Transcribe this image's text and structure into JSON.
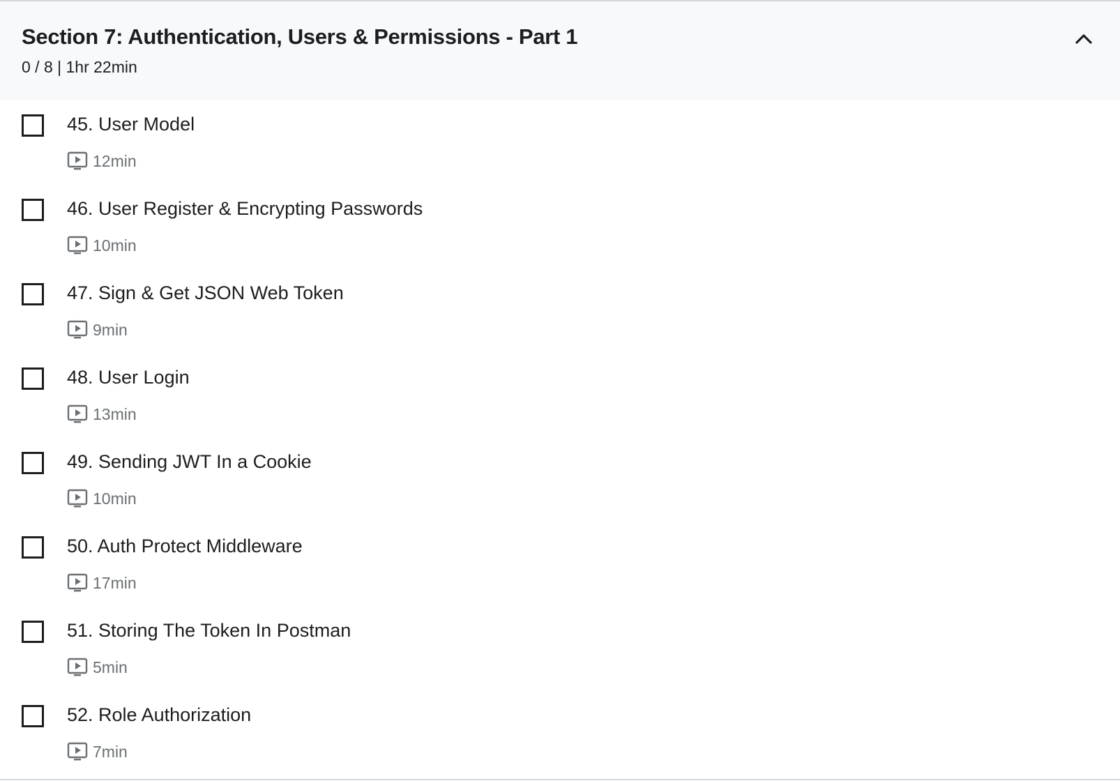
{
  "section": {
    "title": "Section 7: Authentication, Users & Permissions - Part 1",
    "meta": "0 / 8 | 1hr 22min",
    "toggle_icon": "chevron-up-icon",
    "lectures": [
      {
        "title": "45. User Model",
        "duration": "12min",
        "completed": false,
        "icon": "video-icon"
      },
      {
        "title": "46. User Register & Encrypting Passwords",
        "duration": "10min",
        "completed": false,
        "icon": "video-icon"
      },
      {
        "title": "47. Sign & Get JSON Web Token",
        "duration": "9min",
        "completed": false,
        "icon": "video-icon"
      },
      {
        "title": "48. User Login",
        "duration": "13min",
        "completed": false,
        "icon": "video-icon"
      },
      {
        "title": "49. Sending JWT In a Cookie",
        "duration": "10min",
        "completed": false,
        "icon": "video-icon"
      },
      {
        "title": "50. Auth Protect Middleware",
        "duration": "17min",
        "completed": false,
        "icon": "video-icon"
      },
      {
        "title": "51. Storing The Token In Postman",
        "duration": "5min",
        "completed": false,
        "icon": "video-icon"
      },
      {
        "title": "52. Role Authorization",
        "duration": "7min",
        "completed": false,
        "icon": "video-icon"
      }
    ]
  },
  "colors": {
    "header_background": "#f7f9fa",
    "text_primary": "#1c1d1f",
    "text_secondary": "#6a6f73",
    "border": "#d1d7dc"
  }
}
